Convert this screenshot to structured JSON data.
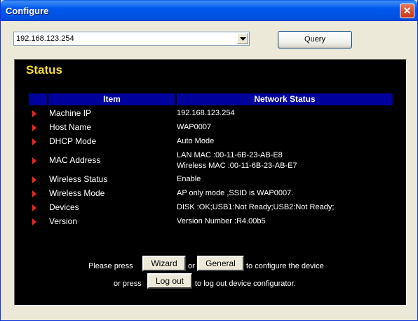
{
  "window": {
    "title": "Configure",
    "close_glyph": "✕"
  },
  "toolbar": {
    "device_selected": "192.168.123.254",
    "query_label": "Query"
  },
  "status": {
    "heading": "Status",
    "columns": [
      "Item",
      "Network Status"
    ],
    "rows": [
      {
        "item": "Machine IP",
        "value": "192.168.123.254"
      },
      {
        "item": "Host Name",
        "value": "WAP0007"
      },
      {
        "item": "DHCP Mode",
        "value": "Auto Mode"
      },
      {
        "item": "MAC Address",
        "value": "LAN MAC :00-11-6B-23-AB-E8",
        "value2": "Wireless MAC :00-11-6B-23-AB-E7"
      },
      {
        "item": "Wireless Status",
        "value": "Enable"
      },
      {
        "item": "Wireless Mode",
        "value": "AP only mode ,SSID is WAP0007."
      },
      {
        "item": "Devices",
        "value": "DISK :OK;USB1:Not Ready;USB2:Not Ready;"
      },
      {
        "item": "Version",
        "value": "Version Number :R4.00b5"
      }
    ]
  },
  "footer": {
    "press_text": "Please press",
    "wizard_label": "Wizard",
    "or_text": "or",
    "general_label": "General",
    "configure_text": "to configure the device",
    "or_press_text": "or press",
    "logout_label": "Log out",
    "logout_text": "to log out device configurator."
  },
  "colors": {
    "panel_bg": "#000000",
    "heading": "#F8DC3C",
    "table_header": "#00009C",
    "bullet": "#E8281C",
    "title_bar": "#0058EE"
  },
  "icons": {
    "row_marker": "red-triangle-bullet-icon",
    "dropdown": "chevron-down-icon",
    "close": "close-icon"
  }
}
